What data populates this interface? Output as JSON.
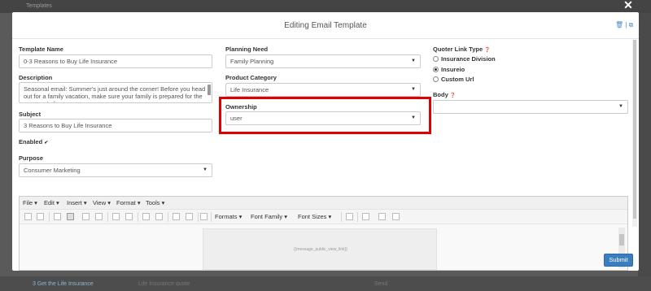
{
  "background": {
    "topbar_text": "Templates",
    "bottom_link": "3 Get the Life Insurance",
    "bottom_text1": "Life Insurance quote",
    "bottom_text2": "Send"
  },
  "modal": {
    "title": "Editing Email Template",
    "header_icons": "🗑 | ⧉",
    "close_glyph": "✕"
  },
  "form": {
    "template_name": {
      "label": "Template Name",
      "value": "0-3 Reasons to Buy Life Insurance"
    },
    "description": {
      "label": "Description",
      "value": "Seasonal email: Summer's just around the corner! Before you head out for a family vacation, make sure your family is  prepared for the unexpected."
    },
    "subject": {
      "label": "Subject",
      "value": "3 Reasons to Buy Life Insurance"
    },
    "enabled": {
      "label": "Enabled",
      "checked_glyph": "✔"
    },
    "purpose": {
      "label": "Purpose",
      "value": "Consumer Marketing"
    },
    "planning_need": {
      "label": "Planning Need",
      "value": "Family Planning"
    },
    "product_category": {
      "label": "Product Category",
      "value": "Life Insurance"
    },
    "ownership": {
      "label": "Ownership",
      "value": "user"
    },
    "quoter_link_type": {
      "label": "Quoter Link Type",
      "help_glyph": "❓",
      "options": [
        {
          "label": "Insurance Division",
          "selected": false
        },
        {
          "label": "Insureio",
          "selected": true
        },
        {
          "label": "Custom Url",
          "selected": false
        }
      ]
    },
    "body": {
      "label": "Body",
      "help_glyph": "❓",
      "value": ""
    }
  },
  "editor": {
    "menu": [
      "File",
      "Edit",
      "Insert",
      "View",
      "Format",
      "Tools"
    ],
    "dropdowns": [
      "Formats",
      "Font Family",
      "Font Sizes"
    ],
    "placeholder": "{{message_public_view_link}}"
  },
  "footer": {
    "submit_label": "Submit"
  },
  "colors": {
    "accent": "#3b7ec0",
    "highlight": "#e00000"
  }
}
